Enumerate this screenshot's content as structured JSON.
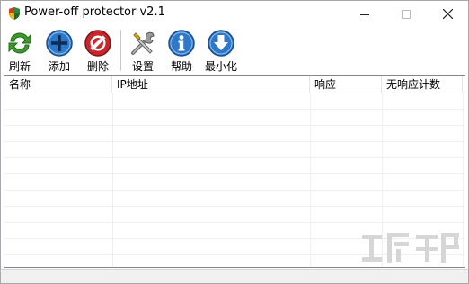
{
  "window": {
    "title": "Power-off protector v2.1",
    "controls": {
      "minimize": "minimize-icon",
      "maximize": "maximize-icon",
      "close": "close-icon"
    }
  },
  "toolbar": {
    "buttons": [
      {
        "label": "刷新",
        "icon": "refresh-icon"
      },
      {
        "label": "添加",
        "icon": "add-icon"
      },
      {
        "label": "删除",
        "icon": "delete-icon"
      },
      {
        "label": "设置",
        "icon": "settings-icon"
      },
      {
        "label": "帮助",
        "icon": "help-icon"
      },
      {
        "label": "最小化",
        "icon": "minimize-down-icon"
      }
    ]
  },
  "list": {
    "columns": [
      "名称",
      "IP地址",
      "响应",
      "无响应计数"
    ],
    "rows": []
  },
  "status": {
    "text": ""
  },
  "colors": {
    "refresh_green": "#3a9a2a",
    "add_blue": "#2f78c8",
    "delete_red": "#c8262a",
    "help_blue": "#2f78c8"
  }
}
